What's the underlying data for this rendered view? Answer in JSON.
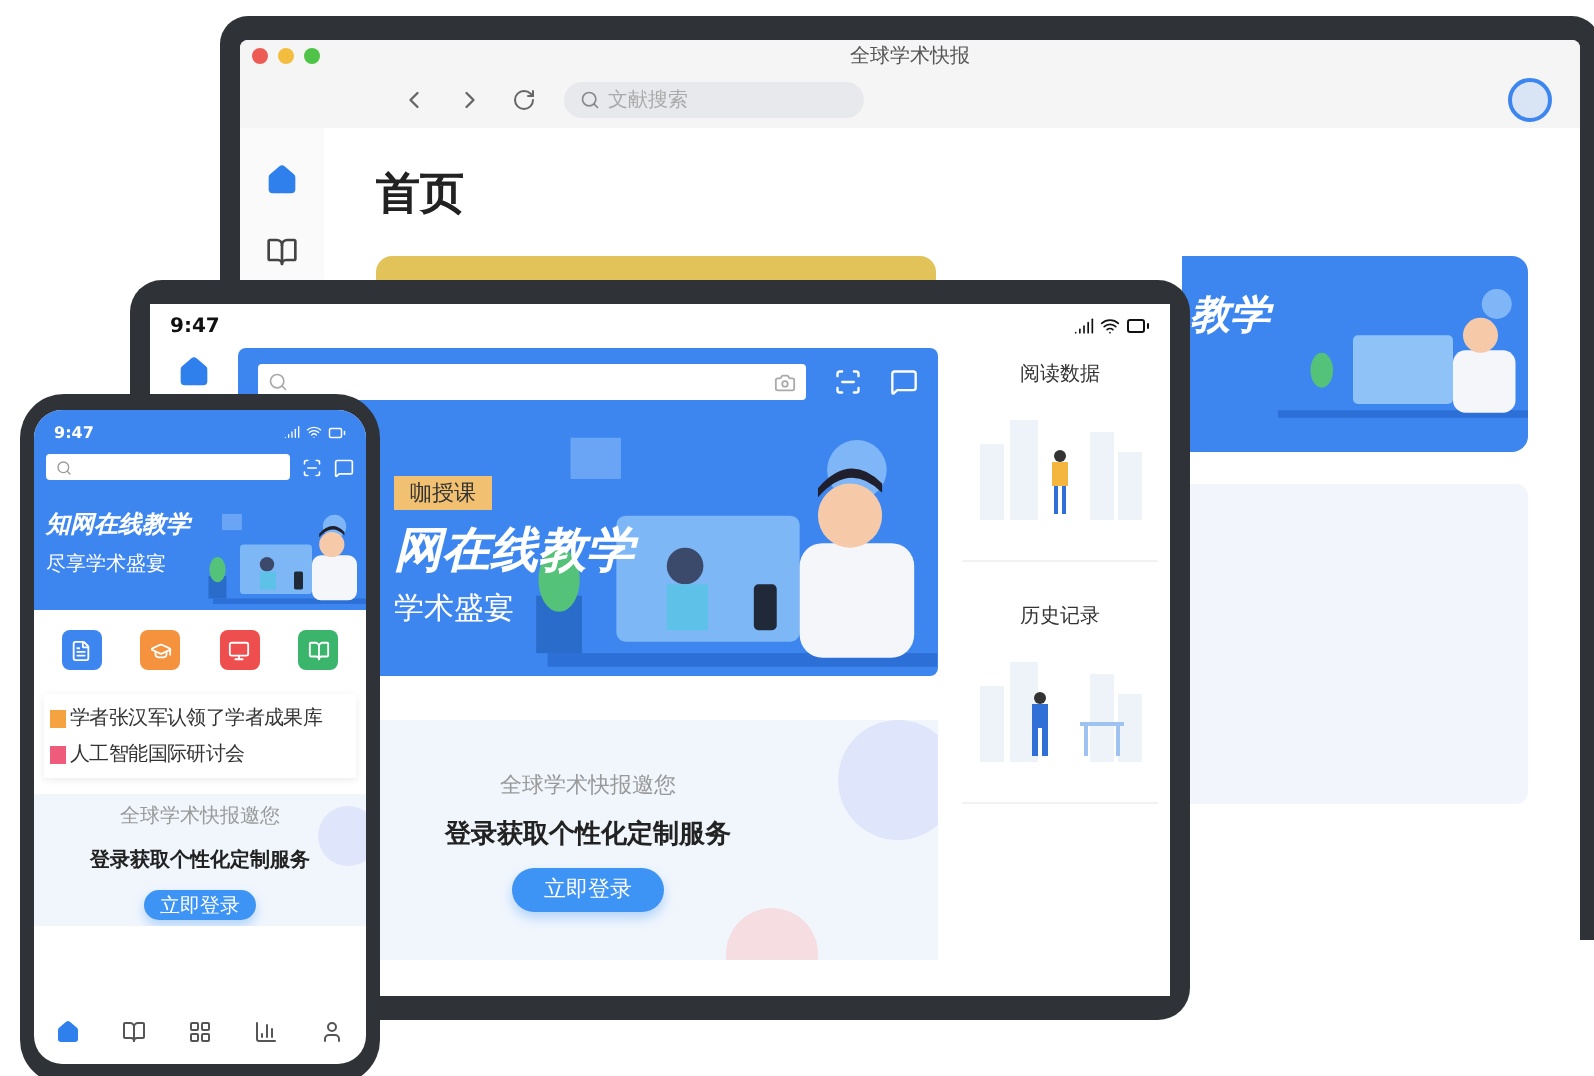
{
  "laptop": {
    "window_title": "全球学术快报",
    "search": {
      "placeholder": "文献搜索"
    },
    "sidebar": [
      {
        "selected": true
      },
      {
        "selected": false
      }
    ],
    "page_title": "首页",
    "banner_text": "教学"
  },
  "tablet": {
    "time": "9:47",
    "banner": {
      "tag": "咖授课",
      "title": "网在线教学",
      "subtitle": "学术盛宴"
    },
    "invite": {
      "caption": "全球学术快报邀您",
      "headline": "登录获取个性化定制服务",
      "button": "立即登录"
    },
    "side_cards": [
      {
        "title": "阅读数据"
      },
      {
        "title": "历史记录"
      }
    ]
  },
  "phone": {
    "time": "9:47",
    "banner": {
      "title": "知网在线教学",
      "subtitle": "尽享学术盛宴"
    },
    "shortcuts": [
      {
        "color": "#3d86f0"
      },
      {
        "color": "#f5923e"
      },
      {
        "color": "#ef4e4e"
      },
      {
        "color": "#3bb56b"
      }
    ],
    "news": [
      {
        "color": "#f5a340",
        "text": "学者张汉军认领了学者成果库"
      },
      {
        "color": "#ef5b7a",
        "text": "人工智能国际研讨会"
      }
    ],
    "invite": {
      "caption": "全球学术快报邀您",
      "headline": "登录获取个性化定制服务",
      "button": "立即登录"
    },
    "tabs": [
      {
        "selected": true
      },
      {
        "selected": false
      },
      {
        "selected": false
      },
      {
        "selected": false
      },
      {
        "selected": false
      }
    ]
  }
}
